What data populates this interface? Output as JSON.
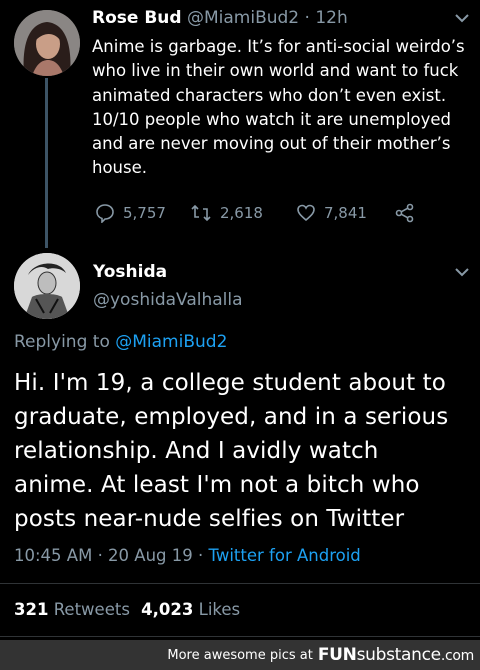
{
  "original_tweet": {
    "display_name": "Rose Bud",
    "handle": "@MiamiBud2",
    "time": "· 12h",
    "lines": [
      "Anime is garbage. It’s for anti-social weirdo’s",
      "who live in their own world and want to fuck",
      "animated characters who don’t even exist.",
      "10/10 people who watch it are unemployed",
      "and are never moving out of their mother’s",
      "house."
    ],
    "replies": "5,757",
    "retweets": "2,618",
    "likes": "7,841"
  },
  "reply_tweet": {
    "display_name": "Yoshida",
    "handle": "@yoshidaValhalla",
    "replying_prefix": "Replying to",
    "replying_handle": "@MiamiBud2",
    "lines": [
      "Hi. I'm 19, a college student about to",
      "graduate, employed, and in a serious",
      "relationship. And I avidly watch",
      "anime. At least I'm not a bitch who",
      "posts near-nude selfies on Twitter"
    ],
    "timestamp": "10:45 AM · 20 Aug 19 ·",
    "source": "Twitter for Android",
    "retweet_count": "321",
    "retweet_label": "Retweets",
    "like_count": "4,023",
    "like_label": "Likes"
  },
  "footer": {
    "text": "More awesome pics at",
    "brand_a": "FUN",
    "brand_b": "substance",
    "brand_c": ".com"
  },
  "colors": {
    "background": "#000000",
    "link": "#1da1f2",
    "muted": "#8899a6",
    "thread_line": "#3d5466",
    "footer_bg": "#333333"
  }
}
